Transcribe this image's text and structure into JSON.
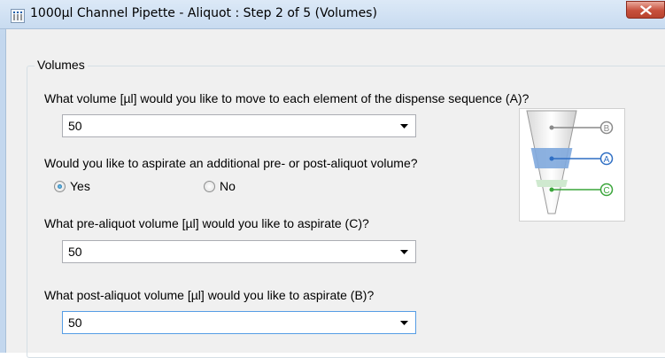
{
  "window": {
    "title": "1000µl Channel Pipette - Aliquot : Step 2 of 5 (Volumes)",
    "icon": "pipette-channels-icon",
    "close_icon": "close-x-icon"
  },
  "group": {
    "title": "Volumes"
  },
  "questions": {
    "dispense_volume": {
      "label": "What volume [µl] would you like to move to each element of the dispense sequence (A)?",
      "value": "50"
    },
    "additional_volume": {
      "label": "Would you like to aspirate an additional pre- or post-aliquot volume?",
      "options": [
        "Yes",
        "No"
      ],
      "selected": "Yes"
    },
    "pre_aliquot": {
      "label": "What pre-aliquot volume [µl] would you like to aspirate (C)?",
      "value": "50"
    },
    "post_aliquot": {
      "label": "What post-aliquot volume [µl] would you like to aspirate (B)?",
      "value": "50"
    }
  },
  "illustration": {
    "markers": [
      "B",
      "A",
      "C"
    ],
    "colors": {
      "B": "#8a8a8a",
      "A": "#2f6fc4",
      "C": "#3aa53a"
    }
  }
}
